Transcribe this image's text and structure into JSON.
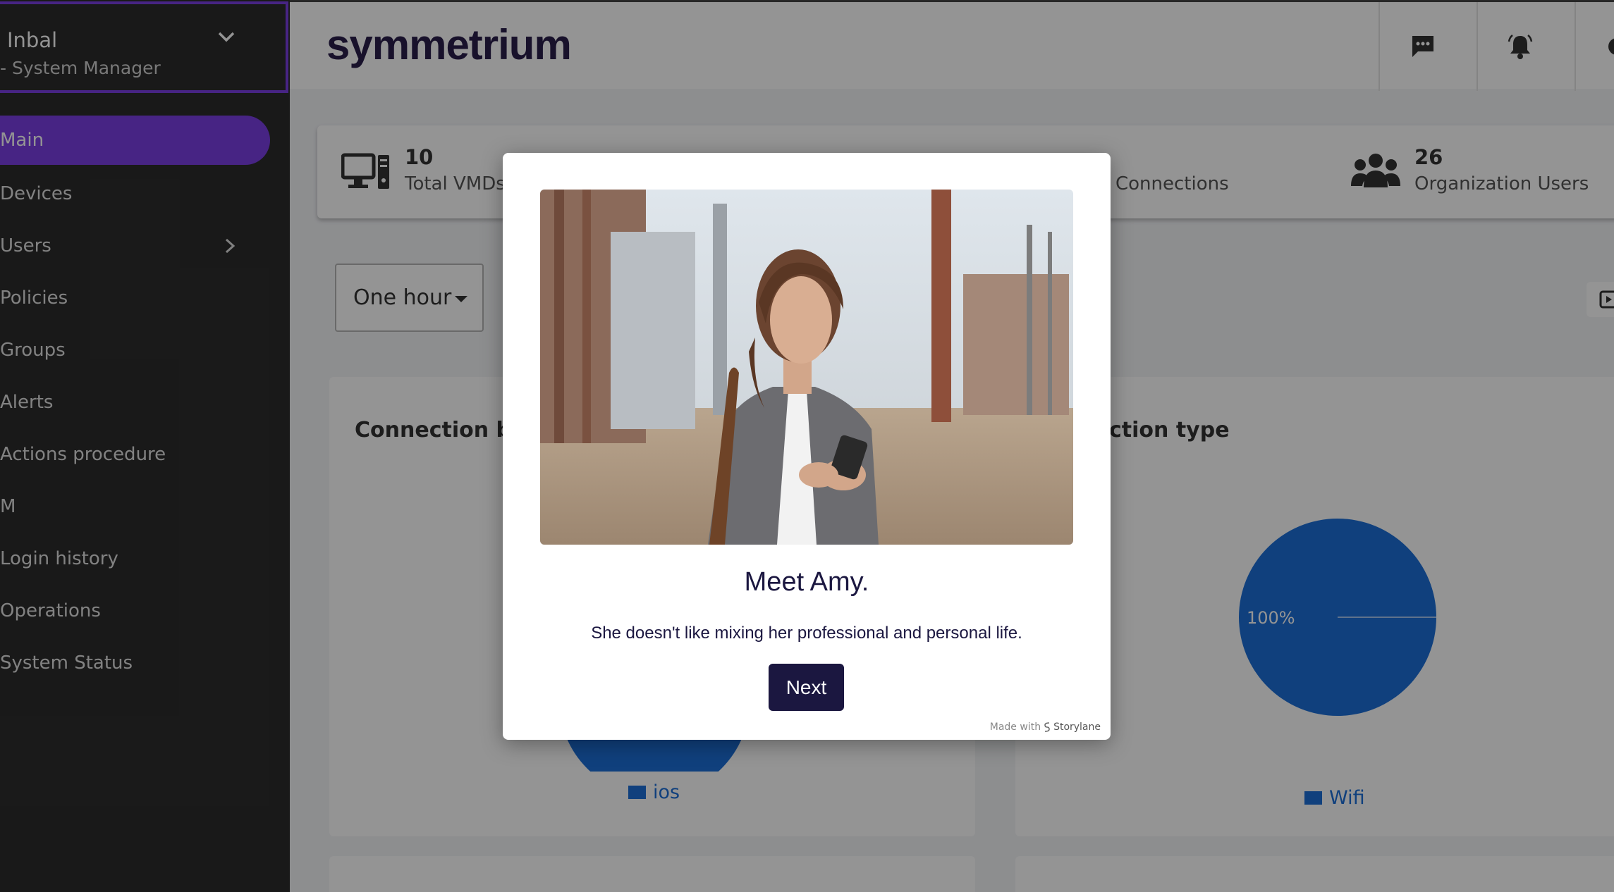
{
  "user": {
    "name": "Inbal",
    "role": "- System Manager"
  },
  "nav": {
    "items": [
      {
        "label": "Main"
      },
      {
        "label": "Devices"
      },
      {
        "label": "Users"
      },
      {
        "label": "Policies"
      },
      {
        "label": "Groups"
      },
      {
        "label": "Alerts"
      },
      {
        "label": "Actions procedure"
      },
      {
        "label": "M"
      },
      {
        "label": "Login history"
      },
      {
        "label": "Operations"
      },
      {
        "label": "System Status"
      }
    ]
  },
  "header": {
    "logo": "symmetrium"
  },
  "stats": [
    {
      "value": "10",
      "label": "Total VMDs"
    },
    {
      "value": "",
      "label": "Connections"
    },
    {
      "value": "26",
      "label": "Organization Users"
    }
  ],
  "filters": {
    "range": "One hour"
  },
  "cards": {
    "left": {
      "title": "Connection by",
      "legend": "ios"
    },
    "right": {
      "title": "ction type",
      "legend": "Wifi",
      "slice_label": "100%"
    }
  },
  "colors": {
    "accent": "#7b3fe4",
    "chart": "#1c6fd8",
    "modal_text": "#1b1740"
  },
  "modal": {
    "title": "Meet Amy.",
    "text": "She doesn't like mixing her professional and personal life.",
    "button": "Next",
    "made_with": "Made with",
    "brand": "Storylane"
  }
}
